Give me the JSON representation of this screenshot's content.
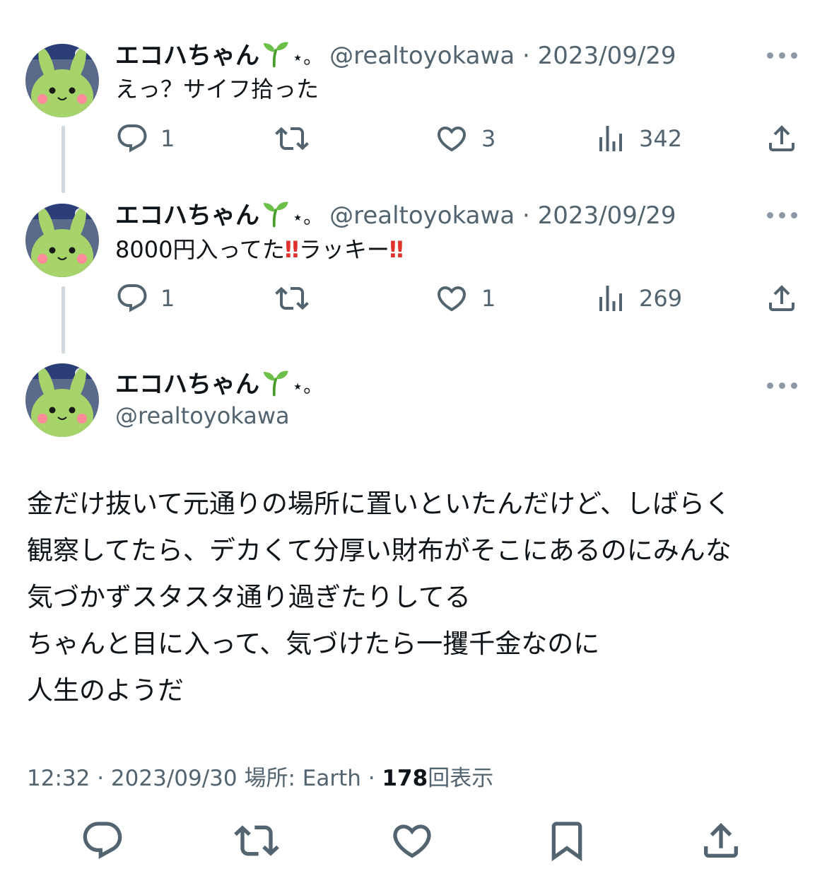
{
  "colors": {
    "text": "#0f1419",
    "secondary": "#536471",
    "thread_line": "#cfd9de",
    "emphasis_red": "#e0322c",
    "avatar_green": "#a6d36a"
  },
  "icons": {
    "reply": "speech-bubble-icon",
    "retweet": "retweet-arrows-icon",
    "like": "heart-icon",
    "views": "bar-chart-icon",
    "share": "share-upload-icon",
    "bookmark": "bookmark-icon",
    "more": "ellipsis-icon",
    "name_decoration": "sprout-emoji-icon"
  },
  "thread": [
    {
      "display_name": "エコハちゃん",
      "name_suffix": "⋆。",
      "handle": "@realtoyokawa",
      "separator": "·",
      "date": "2023/09/29",
      "text": "えっ？サイフ拾った",
      "reply_count": "1",
      "like_count": "3",
      "view_count": "342"
    },
    {
      "display_name": "エコハちゃん",
      "name_suffix": "⋆。",
      "handle": "@realtoyokawa",
      "separator": "·",
      "date": "2023/09/29",
      "text_a": "8000円入ってた",
      "text_b": "‼",
      "text_c": "ラッキー",
      "text_d": "‼",
      "reply_count": "1",
      "like_count": "1",
      "view_count": "269"
    }
  ],
  "main_tweet": {
    "display_name": "エコハちゃん",
    "name_suffix": "⋆。",
    "handle": "@realtoyokawa",
    "lines": [
      "金だけ抜いて元通りの場所に置いといたんだけど、しばらく",
      "観察してたら、デカくて分厚い財布がそこにあるのにみんな",
      "気づかずスタスタ通り過ぎたりしてる",
      "ちゃんと目に入って、気づけたら一攫千金なのに",
      "人生のようだ"
    ],
    "time": "12:32",
    "sep1": "·",
    "date": "2023/09/30",
    "location_label": "場所: Earth",
    "sep2": "·",
    "view_count": "178",
    "view_label": "回表示"
  }
}
